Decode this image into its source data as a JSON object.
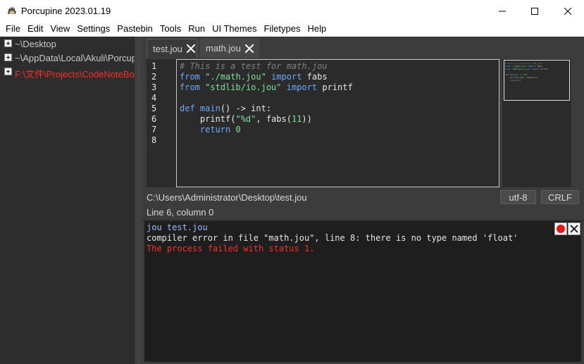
{
  "window": {
    "title": "Porcupine 2023.01.19",
    "icon": "porcupine-app-icon"
  },
  "menu": {
    "items": [
      "File",
      "Edit",
      "View",
      "Settings",
      "Pastebin",
      "Tools",
      "Run",
      "UI Themes",
      "Filetypes",
      "Help"
    ]
  },
  "sidebar": {
    "items": [
      {
        "label": "~\\Desktop",
        "color": "#c8c8c8"
      },
      {
        "label": "~\\AppData\\Local\\Akuli\\Porcupine",
        "color": "#c8c8c8"
      },
      {
        "label": "F:\\文件\\Projects\\CodeNoteBook",
        "color": "#ff2a2a"
      }
    ]
  },
  "tabs": [
    {
      "label": "test.jou",
      "active": true
    },
    {
      "label": "math.jou",
      "active": false
    }
  ],
  "editor": {
    "line_numbers": [
      "1",
      "2",
      "3",
      "4",
      "5",
      "6",
      "7",
      "8"
    ]
  },
  "status": {
    "path": "C:\\Users\\Administrator\\Desktop\\test.jou",
    "encoding": "utf-8",
    "line_ending": "CRLF",
    "cursor": "Line 6, column 0"
  },
  "output": {
    "command": "jou test.jou",
    "error": "compiler error in file \"math.jou\", line 8: there is no type named 'float'",
    "failure": "The process failed with status 1."
  },
  "colors": {
    "sidebar_bg": "#2d2d2d",
    "editor_bg": "#2b2b2b",
    "keyword": "#6aa9ff",
    "string": "#7ee09a",
    "comment": "#808080",
    "error_red": "#ff2a2a"
  }
}
